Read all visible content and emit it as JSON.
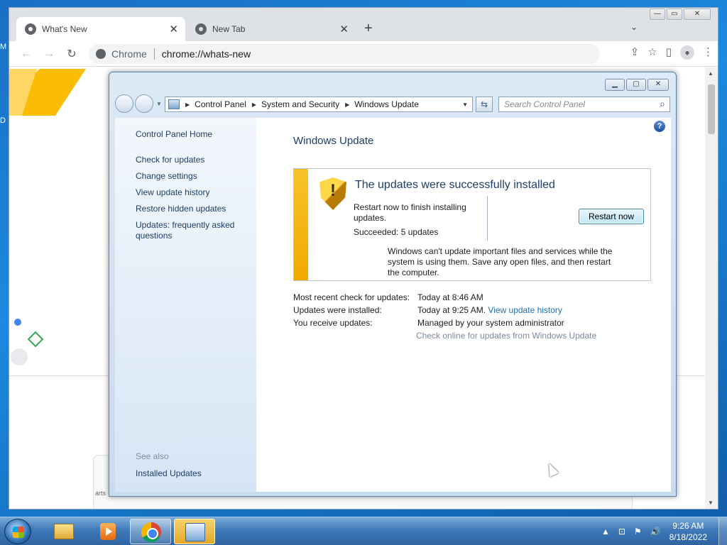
{
  "desktop": {
    "frag_top": "M",
    "frag_mid": "D"
  },
  "chrome": {
    "tabs": [
      {
        "label": "What's New",
        "active": true
      },
      {
        "label": "New Tab",
        "active": false
      }
    ],
    "new_tab_glyph": "+",
    "tab_search_glyph": "⌄",
    "window_controls": {
      "minimize": "—",
      "maximize": "▭",
      "close": "✕"
    },
    "toolbar": {
      "back": "←",
      "forward": "→",
      "reload": "↻",
      "site_label": "Chrome",
      "url": "chrome://whats-new",
      "share": "⇪",
      "bookmark": "☆",
      "side_panel": "▯",
      "profile": "●",
      "menu": "⋮"
    },
    "content": {
      "card_text": "arts"
    }
  },
  "control_panel": {
    "window_controls": {
      "minimize": "▁",
      "maximize": "▢",
      "close": "✕"
    },
    "breadcrumbs": [
      "Control Panel",
      "System and Security",
      "Windows Update"
    ],
    "search_placeholder": "Search Control Panel",
    "refresh_glyph": "⇆",
    "search_glyph": "⌕",
    "help_glyph": "?",
    "sidebar": {
      "home": "Control Panel Home",
      "links": [
        "Check for updates",
        "Change settings",
        "View update history",
        "Restore hidden updates",
        "Updates: frequently asked questions"
      ],
      "see_also_label": "See also",
      "see_also_links": [
        "Installed Updates"
      ]
    },
    "main": {
      "title": "Windows Update",
      "status_box": {
        "headline": "The updates were successfully installed",
        "restart_text": "Restart now to finish installing updates.",
        "succeeded": "Succeeded: 5 updates",
        "restart_button": "Restart now",
        "note": "Windows can't update important files and services while the system is using them. Save any open files, and then restart the computer.",
        "shield_mark": "!"
      },
      "info": {
        "recent_check_label": "Most recent check for updates:",
        "recent_check_value": "Today at 8:46 AM",
        "installed_label": "Updates were installed:",
        "installed_value": "Today at 9:25 AM.",
        "installed_link": "View update history",
        "receive_label": "You receive updates:",
        "receive_value": "Managed by your system administrator",
        "check_online": "Check online for updates from Windows Update"
      }
    }
  },
  "taskbar": {
    "apps": [
      "Windows Explorer",
      "Windows Media Player",
      "Google Chrome",
      "Control Panel"
    ],
    "tray": {
      "show_hidden": "▲",
      "network": "⊡",
      "flag": "⚑",
      "volume": "🔊"
    },
    "clock": {
      "time": "9:26 AM",
      "date": "8/18/2022"
    }
  }
}
